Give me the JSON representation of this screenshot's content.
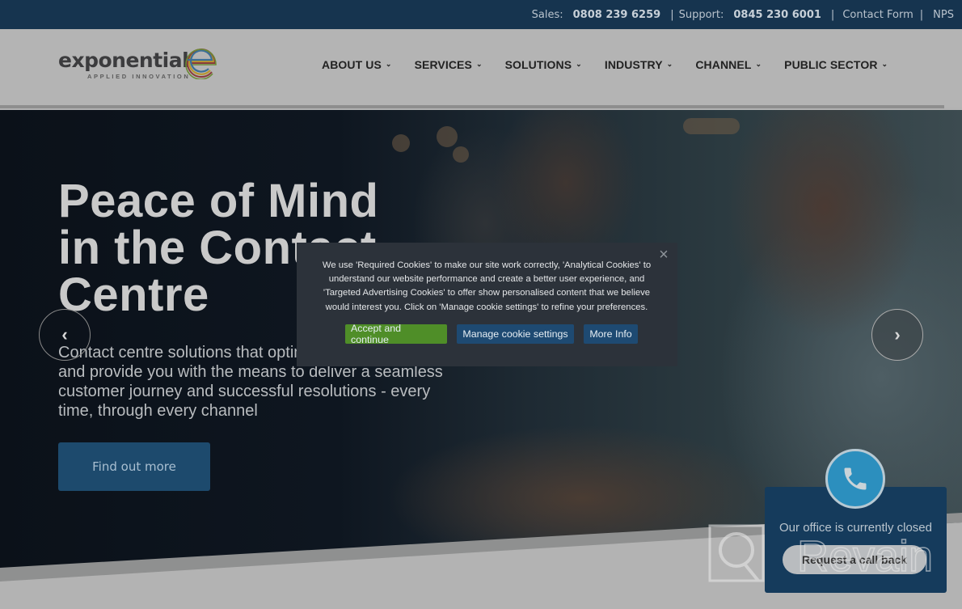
{
  "topbar": {
    "sales_label": "Sales:",
    "sales_number": "0808 239 6259",
    "support_label": "Support:",
    "support_number": "0845 230 6001",
    "contact_form": "Contact Form",
    "nps": "NPS",
    "separator": "|"
  },
  "header": {
    "logo_text": "exponential-",
    "logo_tagline": "APPLIED INNOVATION",
    "nav": [
      {
        "label": "ABOUT US"
      },
      {
        "label": "SERVICES"
      },
      {
        "label": "SOLUTIONS"
      },
      {
        "label": "INDUSTRY"
      },
      {
        "label": "CHANNEL"
      },
      {
        "label": "PUBLIC SECTOR"
      }
    ],
    "chevron": "⌄"
  },
  "hero": {
    "title_lines": [
      "Peace of Mind",
      "in the Contact",
      "Centre"
    ],
    "subtitle": "Contact centre solutions that optimise every interaction and provide you with the means to deliver a seamless customer journey and successful resolutions - every time, through every channel",
    "cta_label": "Find out more",
    "prev_arrow": "‹",
    "next_arrow": "›"
  },
  "cookie_banner": {
    "text": "We use 'Required Cookies' to make our site work correctly, 'Analytical Cookies' to understand our website performance and create a better user experience, and 'Targeted Advertising Cookies' to offer show personalised content that we believe would interest you. Click on 'Manage cookie settings' to refine your preferences.",
    "accept_label": "Accept and continue",
    "manage_label": "Manage cookie settings",
    "more_info_label": "More Info",
    "close_glyph": "×"
  },
  "callback_widget": {
    "status_text": "Our office is currently closed",
    "button_label": "Request a call back"
  },
  "watermark": {
    "text": "Revain"
  },
  "colors": {
    "topbar_bg": "#16344f",
    "accept_green": "#4f8e28",
    "cookie_blue": "#1e4a72",
    "cta_blue": "#1d4a6d",
    "phone_blue": "#2c8fbe"
  }
}
